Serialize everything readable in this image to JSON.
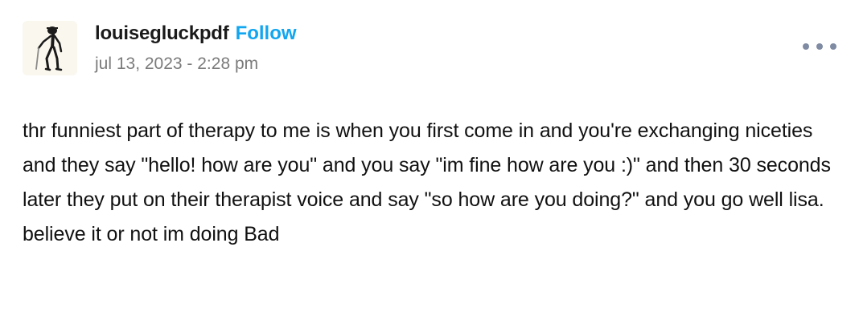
{
  "post": {
    "author": {
      "username": "louisegluckpdf",
      "follow_label": "Follow",
      "avatar_icon": "walking-figure-with-cane-icon"
    },
    "timestamp": "jul 13, 2023 - 2:28 pm",
    "more_icon": "more-options-ellipsis-icon",
    "body": "thr funniest part of therapy to me is when you first come in and you're exchanging niceties and they say \"hello! how are you\" and you say \"im fine how are you :)\" and then 30 seconds later they put on their therapist voice and say \"so how are you doing?\" and you go well lisa. believe it or not im doing Bad"
  },
  "colors": {
    "follow": "#11a6f0",
    "timestamp": "#7b7b7b",
    "more_dots": "#7f8aa3",
    "text": "#111111"
  }
}
